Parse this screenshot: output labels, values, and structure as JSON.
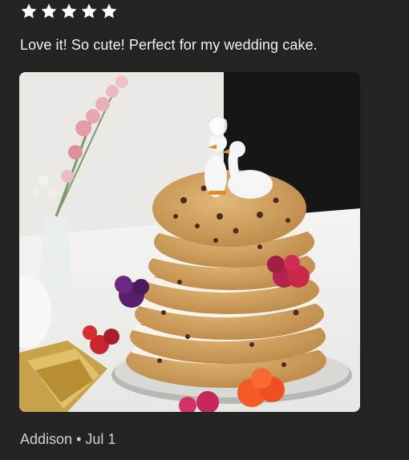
{
  "review": {
    "rating": 5,
    "rating_max": 5,
    "star_color": "#ffffff",
    "text": "Love it! So cute! Perfect for my wedding cake.",
    "photo_icon": "review-photo",
    "reviewer": "Addison",
    "separator": "•",
    "date": "Jul 1"
  }
}
